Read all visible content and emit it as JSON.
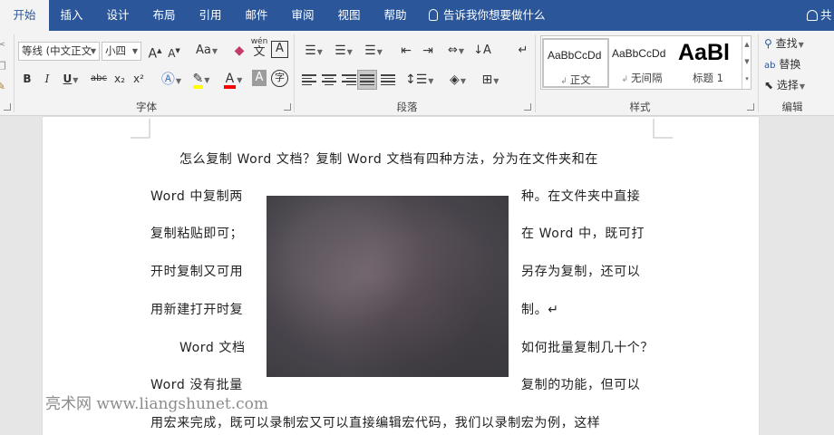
{
  "tabs": [
    {
      "id": "home",
      "label": "开始"
    },
    {
      "id": "insert",
      "label": "插入"
    },
    {
      "id": "design",
      "label": "设计"
    },
    {
      "id": "layout",
      "label": "布局"
    },
    {
      "id": "references",
      "label": "引用"
    },
    {
      "id": "mailings",
      "label": "邮件"
    },
    {
      "id": "review",
      "label": "审阅"
    },
    {
      "id": "view",
      "label": "视图"
    },
    {
      "id": "help",
      "label": "帮助"
    }
  ],
  "tell_me": "告诉我你想要做什么",
  "share_label": "共",
  "ribbon": {
    "font": {
      "font_name": "等线 (中文正文",
      "font_size": "小四",
      "group_label": "字体",
      "pinyin_top": "wén",
      "pinyin_bottom": "文",
      "boxed_char": "A",
      "circled_char": "字",
      "bold": "B",
      "italic": "I",
      "underline": "U",
      "strike": "abc",
      "subscript": "x₂",
      "superscript": "x²",
      "grow": "A",
      "shrink": "A",
      "change_case": "Aa",
      "highlight_color": "#ffff00",
      "font_color": "#ff0000"
    },
    "paragraph": {
      "group_label": "段落"
    },
    "styles": {
      "group_label": "样式",
      "items": [
        {
          "sample": "AaBbCcDd",
          "name": "正文"
        },
        {
          "sample": "AaBbCcDd",
          "name": "无间隔"
        },
        {
          "sample": "AaBl",
          "name": "标题 1"
        }
      ]
    },
    "editing": {
      "group_label": "编辑",
      "find": "查找",
      "replace": "替换",
      "select": "选择"
    }
  },
  "document": {
    "lines": [
      "怎么复制 Word 文档？复制 Word 文档有四种方法，分为在文件夹和在",
      "Word 中复制两",
      "种。在文件夹中直接",
      "复制粘贴即可；",
      "在 Word 中，既可打",
      "开时复制又可用",
      "另存为复制，还可以",
      "用新建打开时复",
      "制。↵",
      "Word 文档",
      "如何批量复制几十个？",
      "Word 没有批量",
      "复制的功能，但可以",
      "用宏来完成，既可以录制宏又可以直接编辑宏代码，我们以录制宏为例，这样"
    ],
    "watermark": "亮术网 www.liangshunet.com"
  }
}
